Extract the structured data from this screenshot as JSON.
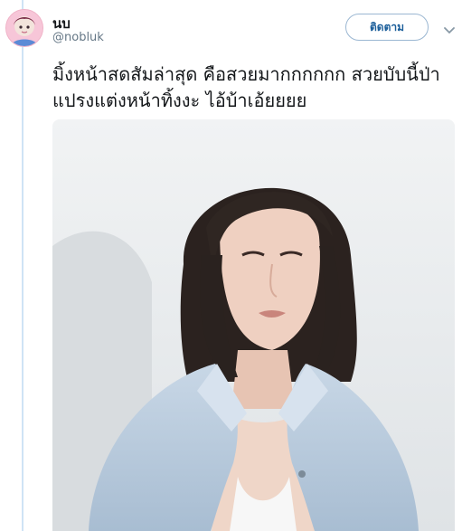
{
  "header": {
    "display_name": "นบ",
    "handle": "@nobluk",
    "follow_label": "ติดตาม",
    "avatar_icon": "avatar-illustration",
    "more_icon": "chevron-down-icon"
  },
  "tweet": {
    "text": "มิ้งหน้าสดสัมล่าสุด คือสวยมากกกกกก สวยบับนี้ป่าแปรงแต่งหน้าทิ้งงะ ไอ้บ้าเอ้ยยยย"
  },
  "media": {
    "type": "photo",
    "subject": "woman-portrait-bob-hair-denim-jacket"
  },
  "colors": {
    "accent": "#1b5e9a",
    "thread_line": "#cfe3f5",
    "text_primary": "#14171a",
    "text_secondary": "#657786"
  }
}
